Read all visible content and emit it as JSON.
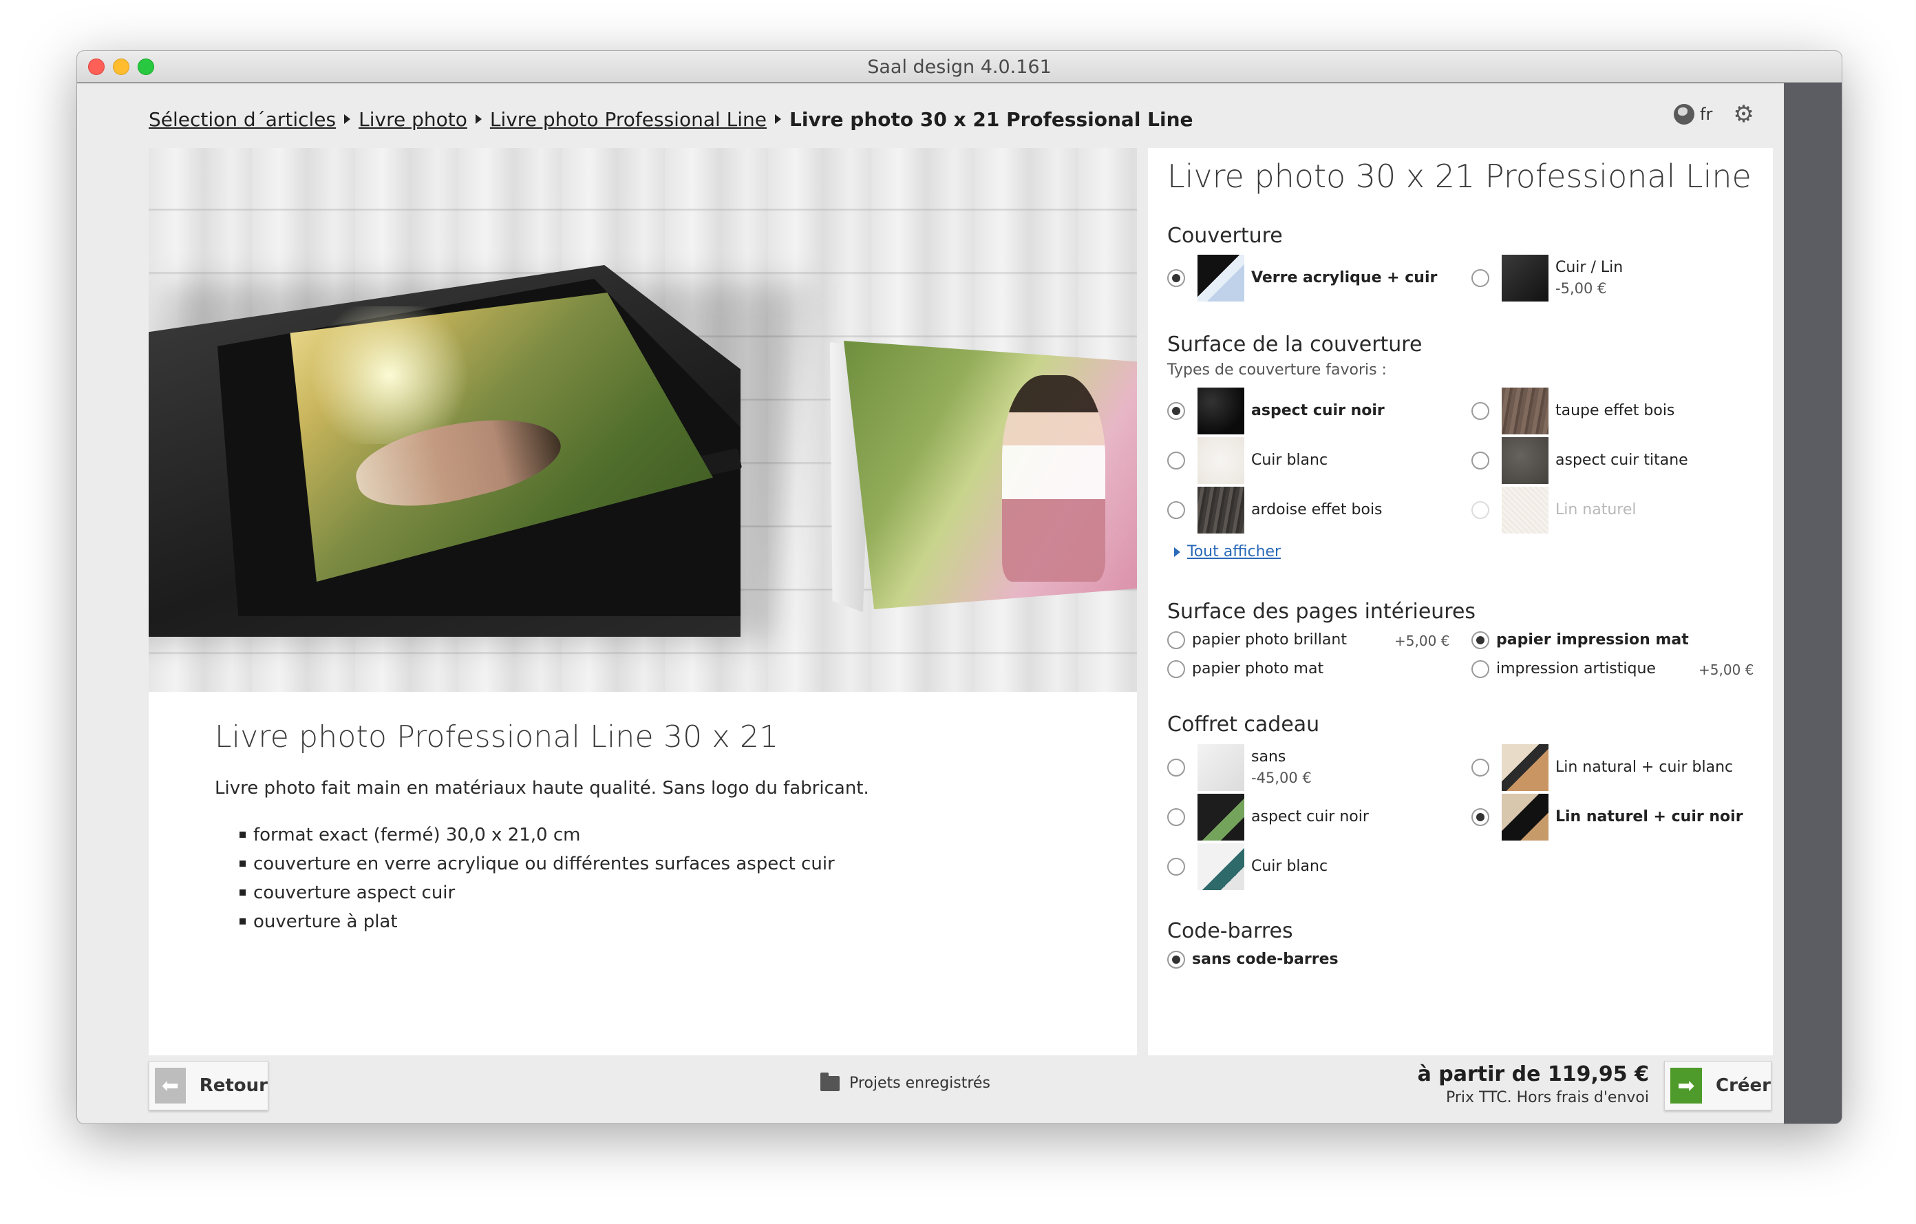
{
  "window": {
    "title": "Saal design 4.0.161"
  },
  "breadcrumb": {
    "items": [
      "Sélection d´articles",
      "Livre photo",
      "Livre photo Professional Line"
    ],
    "current": "Livre photo 30 x 21 Professional Line"
  },
  "toolbar": {
    "language": "fr",
    "globe_icon": "globe-icon",
    "settings_icon": "gear-icon"
  },
  "description": {
    "title": "Livre photo Professional Line 30 x 21",
    "text": "Livre photo fait main en matériaux haute qualité. Sans logo du fabricant.",
    "features": [
      "format exact (fermé) 30,0 x 21,0 cm",
      "couverture en verre acrylique ou différentes surfaces aspect cuir",
      "couverture aspect cuir",
      "ouverture à plat"
    ]
  },
  "config": {
    "title": "Livre photo 30 x 21 Professional Line",
    "cover": {
      "heading": "Couverture",
      "options": [
        {
          "label": "Verre acrylique + cuir",
          "price": "",
          "selected": true
        },
        {
          "label": "Cuir / Lin",
          "price": "-5,00 €",
          "selected": false
        }
      ]
    },
    "surface": {
      "heading": "Surface de la couverture",
      "sublabel": "Types de couverture favoris :",
      "options": [
        {
          "label": "aspect cuir noir",
          "selected": true
        },
        {
          "label": "taupe effet bois",
          "selected": false
        },
        {
          "label": "Cuir blanc",
          "selected": false
        },
        {
          "label": "aspect cuir titane",
          "selected": false
        },
        {
          "label": "ardoise effet bois",
          "selected": false
        },
        {
          "label": "Lin naturel",
          "selected": false,
          "disabled": true
        }
      ],
      "show_all": "Tout afficher"
    },
    "pages": {
      "heading": "Surface des pages intérieures",
      "options": [
        {
          "label": "papier photo brillant",
          "price": "+5,00 €",
          "selected": false
        },
        {
          "label": "papier impression mat",
          "price": "",
          "selected": true
        },
        {
          "label": "papier photo mat",
          "price": "",
          "selected": false
        },
        {
          "label": "impression artistique",
          "price": "+5,00 €",
          "selected": false
        }
      ]
    },
    "gift_box": {
      "heading": "Coffret cadeau",
      "options": [
        {
          "label": "sans",
          "price": "-45,00 €",
          "selected": false
        },
        {
          "label": "Lin natural + cuir blanc",
          "selected": false
        },
        {
          "label": "aspect cuir noir",
          "selected": false
        },
        {
          "label": "Lin naturel + cuir noir",
          "selected": true
        },
        {
          "label": "Cuir blanc",
          "selected": false
        }
      ]
    },
    "barcode": {
      "heading": "Code-barres",
      "options": [
        {
          "label": "sans code-barres",
          "selected": true
        }
      ]
    }
  },
  "footer": {
    "back_label": "Retour",
    "saved_label": "Projets enregistrés",
    "price_main": "à partir de 119,95 €",
    "price_note": "Prix TTC. Hors frais d'envoi",
    "create_label": "Créer"
  }
}
